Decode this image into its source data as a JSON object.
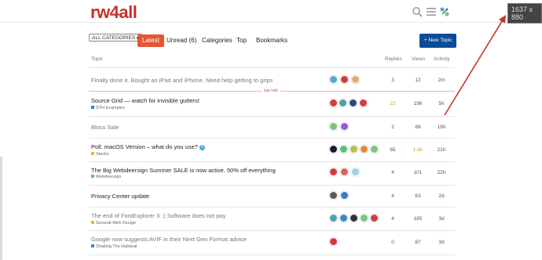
{
  "header": {
    "logo": "rw4all",
    "icons": [
      "search-icon",
      "hamburger-icon",
      "user-avatar-icon"
    ],
    "dimensions_badge": "1637 x 880"
  },
  "nav": {
    "category_dropdown": "ALL CATEGORIES ▸",
    "tabs": [
      "Latest",
      "Unread (6)",
      "Categories",
      "Top",
      "Bookmarks"
    ],
    "active_tab": "Latest",
    "new_topic": "+ New Topic"
  },
  "columns": {
    "topic": "Topic",
    "replies": "Replies",
    "views": "Views",
    "activity": "Activity"
  },
  "last_visit_label": "last visit",
  "topics": [
    {
      "title": "Finally done it. Bought an iPad and iPhone. Need help getting to grips",
      "category": "",
      "replies": "3",
      "views": "12",
      "activity": "2m",
      "read": true,
      "avatars": [
        "#5aa9c6",
        "#d33b3b",
        "#e0b070"
      ]
    },
    {
      "title": "Source Grid — watch for invisible gutters!",
      "category": "STH Examples",
      "category_color": "#3a86c8",
      "replies": "22",
      "views": "196",
      "activity": "5h",
      "read": false,
      "hot": true,
      "avatars": [
        "#d33b3b",
        "#4aa0b0",
        "#2b4a7a",
        "#d33b3b"
      ]
    },
    {
      "title": "Blocs Sale",
      "category": "",
      "replies": "2",
      "views": "88",
      "activity": "19h",
      "read": true,
      "avatars": [
        "#7cc47c",
        "#9b59d0"
      ]
    },
    {
      "title": "Poll: macOS Version – what do you use?",
      "category": "Stacks",
      "category_color": "#f0b429",
      "badge": "3",
      "replies": "65",
      "views": "1.6k",
      "activity": "21h",
      "read": false,
      "hot_views": true,
      "avatars": [
        "#1a1a2e",
        "#5bbf7a",
        "#b8c14a",
        "#e08a3a",
        "#7cc47c"
      ]
    },
    {
      "title": "The Big Webdeersign Summer SALE is now active. 50% off everything",
      "category": "Webdeersign",
      "category_color": "#5bbf7a",
      "replies": "4",
      "views": "101",
      "activity": "22h",
      "read": false,
      "avatars": [
        "#d33b3b",
        "#e06060",
        "#9fd0e8"
      ]
    },
    {
      "title": "Privacy Center update",
      "category": "",
      "replies": "4",
      "views": "63",
      "activity": "2d",
      "read": false,
      "avatars": [
        "#5a5a5a",
        "#3a78c8"
      ]
    },
    {
      "title": "The end of FontExplorer X :( Software does not pay",
      "category": "General Web Design",
      "category_color": "#f0b429",
      "replies": "4",
      "views": "185",
      "activity": "3d",
      "read": true,
      "avatars": [
        "#4aa0b0",
        "#3a86c8",
        "#333333",
        "#7cc47c",
        "#c94040"
      ]
    },
    {
      "title": "Google now suggests AVIF in their Next Gen Format advice",
      "category": "Shaking The Habitual",
      "category_color": "#3a86c8",
      "replies": "0",
      "views": "87",
      "activity": "3d",
      "read": true,
      "avatars": [
        "#d33b3b"
      ]
    }
  ]
}
